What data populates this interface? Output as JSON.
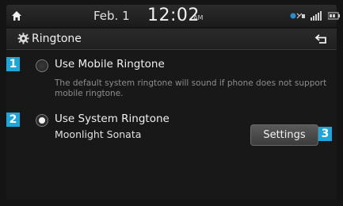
{
  "status_bar": {
    "date": "Feb. 1",
    "time": "12:02",
    "ampm": "AM"
  },
  "header": {
    "title": "Ringtone"
  },
  "options": [
    {
      "marker": "1",
      "label": "Use Mobile Ringtone",
      "description": "The default system ringtone will sound if phone does not support mobile ringtone.",
      "selected": false
    },
    {
      "marker": "2",
      "label": "Use System Ringtone",
      "sub_label": "Moonlight Sonata",
      "selected": true
    }
  ],
  "settings_button": {
    "label": "Settings",
    "marker": "3"
  },
  "colors": {
    "marker": "#1fa5d8",
    "background": "#141414"
  }
}
